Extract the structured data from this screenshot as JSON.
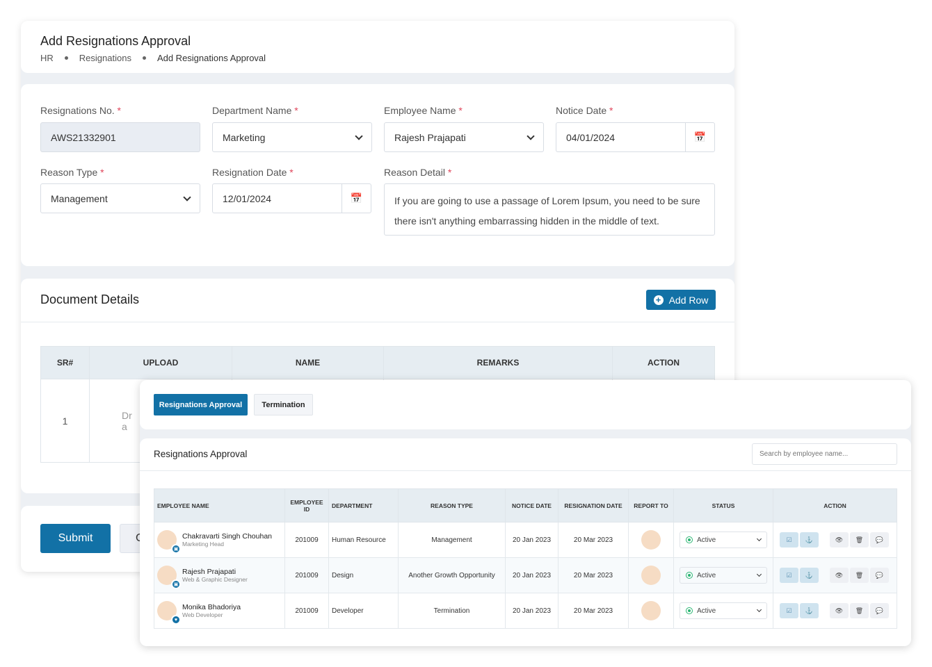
{
  "header": {
    "title": "Add Resignations Approval",
    "breadcrumb": [
      "HR",
      "Resignations",
      "Add Resignations Approval"
    ]
  },
  "form": {
    "resignation_no": {
      "label": "Resignations No.",
      "value": "AWS21332901"
    },
    "department": {
      "label": "Department Name",
      "value": "Marketing"
    },
    "employee": {
      "label": "Employee Name",
      "value": "Rajesh Prajapati"
    },
    "notice_date": {
      "label": "Notice Date",
      "value": "04/01/2024"
    },
    "reason_type": {
      "label": "Reason Type",
      "value": "Management"
    },
    "resignation_date": {
      "label": "Resignation Date",
      "value": "12/01/2024"
    },
    "reason_detail": {
      "label": "Reason Detail",
      "value": "If you are going to use a passage of Lorem Ipsum, you need to be sure there isn't anything embarrassing hidden in the middle of text."
    },
    "required_mark": "*"
  },
  "documents": {
    "title": "Document Details",
    "add_row": "Add Row",
    "columns": [
      "SR#",
      "UPLOAD",
      "NAME",
      "REMARKS",
      "ACTION"
    ],
    "rows": [
      {
        "sr": "1",
        "upload_partial": "Dr",
        "upload_partial2": "a"
      }
    ]
  },
  "footer": {
    "submit": "Submit",
    "cancel_partial": "C"
  },
  "overlay": {
    "tabs": [
      {
        "label": "Resignations Approval",
        "active": true
      },
      {
        "label": "Termination",
        "active": false
      }
    ],
    "title": "Resignations Approval",
    "search_placeholder": "Search by employee name...",
    "columns": [
      "EMPLOYEE NAME",
      "EMPLOYEE ID",
      "DEPARTMENT",
      "REASON TYPE",
      "NOTICE DATE",
      "RESIGNATION DATE",
      "REPORT TO",
      "STATUS",
      "ACTION"
    ],
    "rows": [
      {
        "name": "Chakravarti Singh Chouhan",
        "role": "Marketing Head",
        "id": "201009",
        "department": "Human Resource",
        "reason": "Management",
        "notice": "20 Jan 2023",
        "resignation": "20 Mar 2023",
        "status": "Active",
        "badge": "briefcase-icon"
      },
      {
        "name": "Rajesh Prajapati",
        "role": "Web & Graphic Designer",
        "id": "201009",
        "department": "Design",
        "reason": "Another Growth Opportunity",
        "notice": "20 Jan 2023",
        "resignation": "20 Mar 2023",
        "status": "Active",
        "badge": "briefcase-icon"
      },
      {
        "name": "Monika Bhadoriya",
        "role": "Web Developer",
        "id": "201009",
        "department": "Developer",
        "reason": "Termination",
        "notice": "20 Jan 2023",
        "resignation": "20 Mar 2023",
        "status": "Active",
        "badge": "heart-icon"
      }
    ]
  },
  "colors": {
    "primary": "#1271a6",
    "active": "#2bb673",
    "required": "#e0455a"
  }
}
